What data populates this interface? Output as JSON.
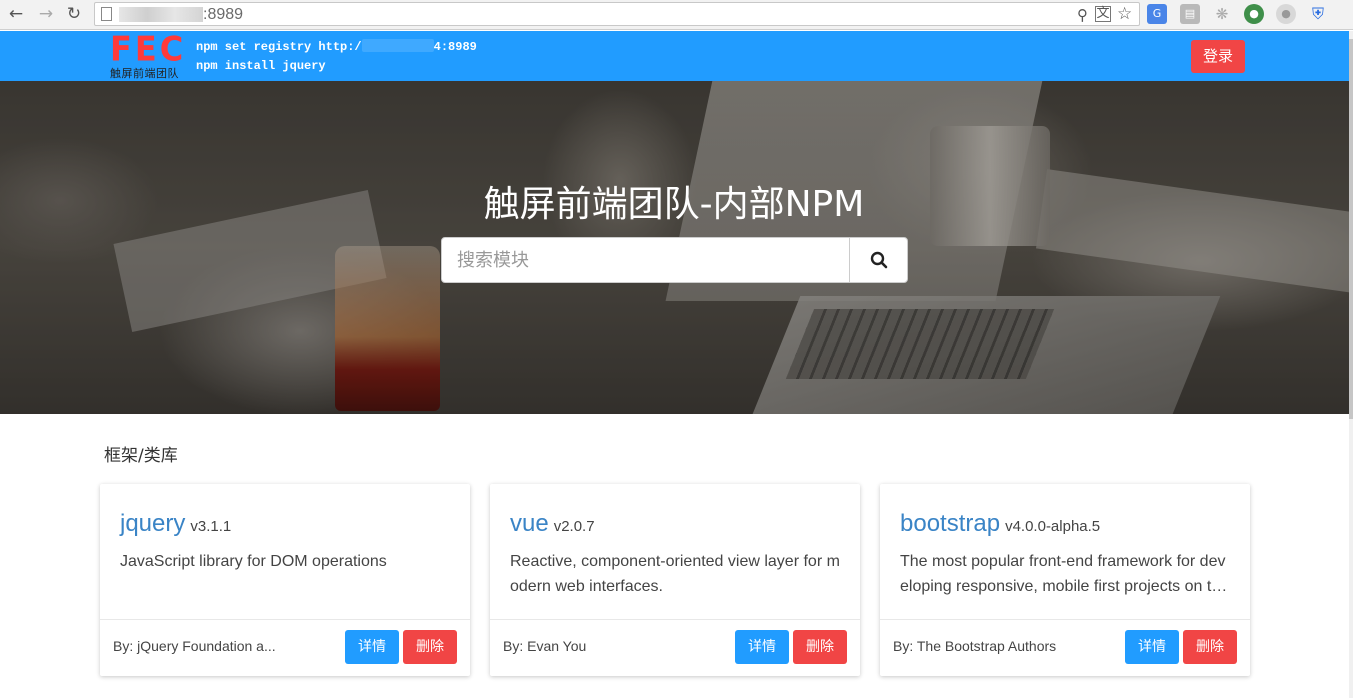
{
  "browser": {
    "url_suffix": ":8989",
    "back_icon": "arrow-left-icon",
    "forward_icon": "arrow-right-icon",
    "reload_icon": "reload-icon"
  },
  "header": {
    "logo_text": "FEC",
    "logo_subtitle": "触屏前端团队",
    "cmd_line1_prefix": "npm set registry http:/",
    "cmd_line1_suffix": "4:8989",
    "cmd_line2": "npm install jquery",
    "login_label": "登录",
    "colors": {
      "bar": "#219cff",
      "logo": "#ff3a3a",
      "login": "#f14545"
    }
  },
  "hero": {
    "title": "触屏前端团队-内部NPM",
    "search_placeholder": "搜索模块",
    "search_icon": "search-icon"
  },
  "section": {
    "title": "框架/类库"
  },
  "cards": [
    {
      "name": "jquery",
      "version": "v3.1.1",
      "description": "JavaScript library for DOM operations",
      "author": "By: jQuery Foundation a...",
      "detail_label": "详情",
      "delete_label": "删除"
    },
    {
      "name": "vue",
      "version": "v2.0.7",
      "description": "Reactive, component-oriented view layer for modern web interfaces.",
      "author": "By: Evan You",
      "detail_label": "详情",
      "delete_label": "删除"
    },
    {
      "name": "bootstrap",
      "version": "v4.0.0-alpha.5",
      "description": "The most popular front-end framework for developing responsive, mobile first projects on the web.",
      "author": "By: The Bootstrap Authors",
      "detail_label": "详情",
      "delete_label": "删除"
    }
  ]
}
